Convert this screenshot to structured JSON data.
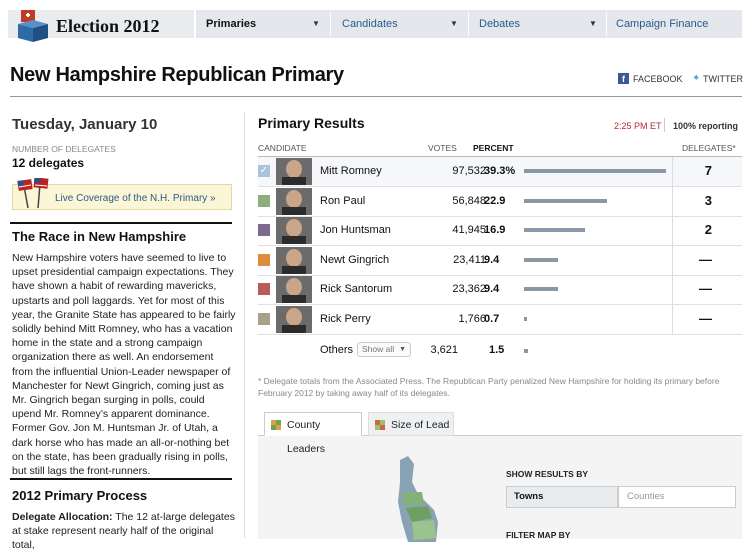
{
  "brand": {
    "title": "Election 2012"
  },
  "nav": [
    {
      "label": "Primaries",
      "active": true
    },
    {
      "label": "Candidates",
      "active": false
    },
    {
      "label": "Debates",
      "active": false
    },
    {
      "label": "Campaign Finance",
      "active": false
    }
  ],
  "page": {
    "title": "New Hampshire Republican Primary"
  },
  "social": {
    "facebook": "FACEBOOK",
    "twitter": "TWITTER"
  },
  "sidebar": {
    "date": "Tuesday, January 10",
    "delegates_label": "NUMBER OF DELEGATES",
    "delegates_value": "12 delegates",
    "live_link": "Live Coverage of the N.H. Primary »",
    "race_heading": "The Race in New Hampshire",
    "race_text": "New Hampshire voters have seemed to live to upset presidential campaign expectations. They have shown a habit of rewarding mavericks, upstarts and poll laggards. Yet for most of this year, the Granite State has appeared to be fairly solidly behind Mitt Romney, who has a vacation home in the state and a strong campaign organization there as well. An endorsement from the influential Union-Leader newspaper of Manchester for Newt Gingrich, coming just as Mr. Gingrich began surging in polls, could upend Mr. Romney’s apparent dominance. Former Gov. Jon M. Huntsman Jr. of Utah, a dark horse who has made an all-or-nothing bet on the state, has been gradually rising in polls, but still lags the front-runners.",
    "process_heading": "2012 Primary Process",
    "process_label": "Delegate Allocation:",
    "process_text": " The 12 at-large delegates at stake represent nearly half of the original total,"
  },
  "results": {
    "title": "Primary Results",
    "time": "2:25 PM ET",
    "reporting": "100% reporting",
    "headers": {
      "candidate": "CANDIDATE",
      "votes": "VOTES",
      "percent": "PERCENT",
      "delegates": "DELEGATES*"
    },
    "rows": [
      {
        "name": "Mitt Romney",
        "votes": "97,532",
        "percent": "39.3%",
        "pct": 39.3,
        "delegates": "7",
        "color": "#a9c4dc",
        "checked": true
      },
      {
        "name": "Ron Paul",
        "votes": "56,848",
        "percent": "22.9",
        "pct": 22.9,
        "delegates": "3",
        "color": "#8fae7c",
        "checked": false
      },
      {
        "name": "Jon Huntsman",
        "votes": "41,945",
        "percent": "16.9",
        "pct": 16.9,
        "delegates": "2",
        "color": "#7b6a8c",
        "checked": false
      },
      {
        "name": "Newt Gingrich",
        "votes": "23,411",
        "percent": "9.4",
        "pct": 9.4,
        "delegates": "—",
        "color": "#e08a3c",
        "checked": false
      },
      {
        "name": "Rick Santorum",
        "votes": "23,362",
        "percent": "9.4",
        "pct": 9.4,
        "delegates": "—",
        "color": "#b85a55",
        "checked": false
      },
      {
        "name": "Rick Perry",
        "votes": "1,766",
        "percent": "0.7",
        "pct": 0.7,
        "delegates": "—",
        "color": "#a8a08a",
        "checked": false
      }
    ],
    "others": {
      "label": "Others",
      "select": "Show all",
      "votes": "3,621",
      "percent": "1.5",
      "pct": 1.5
    },
    "footnote": "* Delegate totals from the Associated Press. The Republican Party penalized New Hampshire for holding its primary before February 2012 by taking away half of its delegates."
  },
  "map": {
    "tabs": [
      {
        "label": "County Leaders",
        "active": true
      },
      {
        "label": "Size of Lead",
        "active": false
      }
    ],
    "show_results_by": "SHOW RESULTS BY",
    "toggle": [
      "Towns",
      "Counties"
    ],
    "filter_map_by": "FILTER MAP BY"
  },
  "colors": {
    "bar": "#8a97a6",
    "nav_link": "#2a5a8c",
    "time": "#b52a2a"
  }
}
